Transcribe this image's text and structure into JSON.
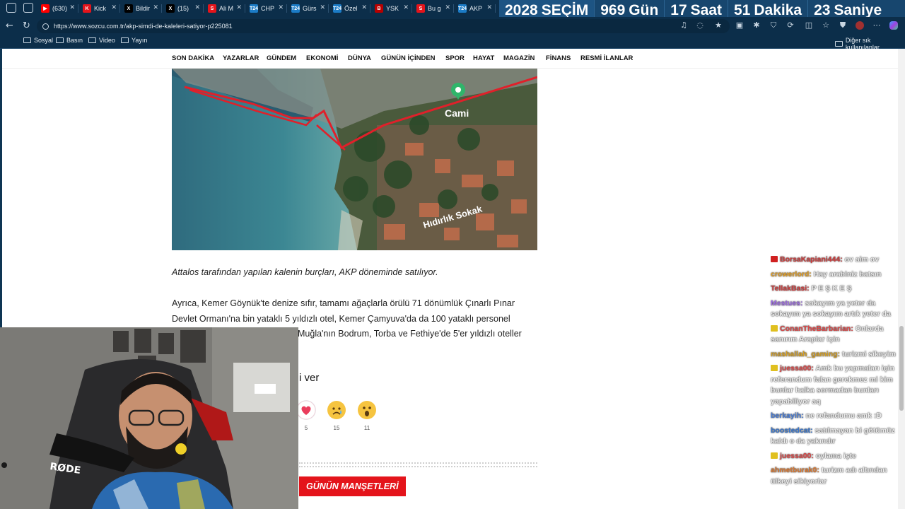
{
  "browser": {
    "tabs": [
      {
        "label": "(630)",
        "icon": "youtube-icon",
        "color": "#ff0000",
        "glyph": "▶"
      },
      {
        "label": "Kick",
        "icon": "kick-icon",
        "color": "#e4141b",
        "glyph": "K"
      },
      {
        "label": "Bildir",
        "icon": "x-icon",
        "color": "#000000",
        "glyph": "X"
      },
      {
        "label": "(15)",
        "icon": "x-icon",
        "color": "#000000",
        "glyph": "X"
      },
      {
        "label": "Ali M",
        "icon": "news-icon",
        "color": "#e4141b",
        "glyph": "S"
      },
      {
        "label": "CHP",
        "icon": "t24-icon",
        "color": "#1c7cc7",
        "glyph": "T24"
      },
      {
        "label": "Gürs",
        "icon": "t24-icon",
        "color": "#1c7cc7",
        "glyph": "T24"
      },
      {
        "label": "Özel",
        "icon": "t24-icon",
        "color": "#1c7cc7",
        "glyph": "T24"
      },
      {
        "label": "YSK",
        "icon": "bbc-icon",
        "color": "#b80000",
        "glyph": "B"
      },
      {
        "label": "Bu g",
        "icon": "news-icon",
        "color": "#e4141b",
        "glyph": "S"
      },
      {
        "label": "AKP",
        "icon": "t24-icon",
        "color": "#1c7cc7",
        "glyph": "T24"
      }
    ],
    "url": "https://www.sozcu.com.tr/akp-simdi-de-kaleleri-satiyor-p225081",
    "bookmarks": [
      "Sosyal",
      "Basın",
      "Video",
      "Yayın"
    ],
    "other_bookmarks": "Diğer sık kullanılanlar"
  },
  "countdown": {
    "year": "2028",
    "label": "SEÇİM",
    "days_value": "969",
    "days_unit": "Gün",
    "hours_value": "17",
    "hours_unit": "Saat",
    "minutes_value": "51",
    "minutes_unit": "Dakika",
    "seconds_value": "23",
    "seconds_unit": "Saniye"
  },
  "site_nav": [
    "SON DAKİKA",
    "YAZARLAR",
    "GÜNDEM",
    "EKONOMİ",
    "DÜNYA",
    "GÜNÜN İÇİNDEN",
    "SPOR",
    "HAYAT",
    "MAGAZİN",
    "FİNANS",
    "RESMİ İLANLAR"
  ],
  "map": {
    "label_mosque": "Cami",
    "label_street": "Hıdırlık Sokak"
  },
  "article": {
    "caption": "Attalos tarafından yapılan kalenin burçları, AKP döneminde satılıyor.",
    "paragraph_lines": [
      "Ayrıca, Kemer Göynük'te denize sıfır, tamamı ağaçlarla örülü 71 dönümlük Çınarlı Pınar",
      "Devlet Ormanı'na bin yataklı 5 yıldızlı otel, Kemer Çamyuva'da da 100 yataklı personel",
      "Muğla'nın Bodrum, Torba ve Fethiye'de 5'er yıldızlı oteller"
    ],
    "reaction_heading": "i ver",
    "reactions": [
      {
        "name": "heart",
        "count": "5"
      },
      {
        "name": "sad",
        "count": "15"
      },
      {
        "name": "surprised",
        "count": "11"
      }
    ],
    "section_title": "GÜNÜN MANŞETLERİ"
  },
  "webcam": {
    "mic_brand": "RØDE"
  },
  "chat": [
    {
      "user": "BorsaKapiani444:",
      "msg": "ov aim ov",
      "color": "#d23c3c",
      "badge": "#d02020"
    },
    {
      "user": "crowerlord:",
      "msg": "Hay arabiniz batsın",
      "color": "#e8a020",
      "badge": ""
    },
    {
      "user": "TellakBasi:",
      "msg": "P E Ş K E Ş",
      "color": "#d23c3c",
      "badge": ""
    },
    {
      "user": "Mestues:",
      "msg": "sokayım ya yeter da sokayım ya sokayım artık yeter da",
      "color": "#a06ce8",
      "badge": ""
    },
    {
      "user": "ConanTheBarbarian:",
      "msg": "Onlarda sanırım Araplar için",
      "color": "#e04848",
      "badge": "#e0c020"
    },
    {
      "user": "mashallah_gaming:",
      "msg": "turizmi sikeyim",
      "color": "#d8a020",
      "badge": ""
    },
    {
      "user": "juessa00:",
      "msg": "Amk bu yapmaları için referandum falan gerekmez mi kim bunlar halka sormadan bunları yapabiliyor aq",
      "color": "#e04848",
      "badge": "#e0c020"
    },
    {
      "user": "berkayih:",
      "msg": "ne refandumu amk :D",
      "color": "#4a7ed8",
      "badge": ""
    },
    {
      "user": "boostedcat:",
      "msg": "satılmayan bi götümüz kaldı o da yakındır",
      "color": "#3a78d0",
      "badge": ""
    },
    {
      "user": "juessa00:",
      "msg": "oylama işte",
      "color": "#e04848",
      "badge": "#e0c020"
    },
    {
      "user": "ahmetburak0:",
      "msg": "turizm adı altından ülkeyi sikiyorlar",
      "color": "#e07a30",
      "badge": ""
    }
  ]
}
